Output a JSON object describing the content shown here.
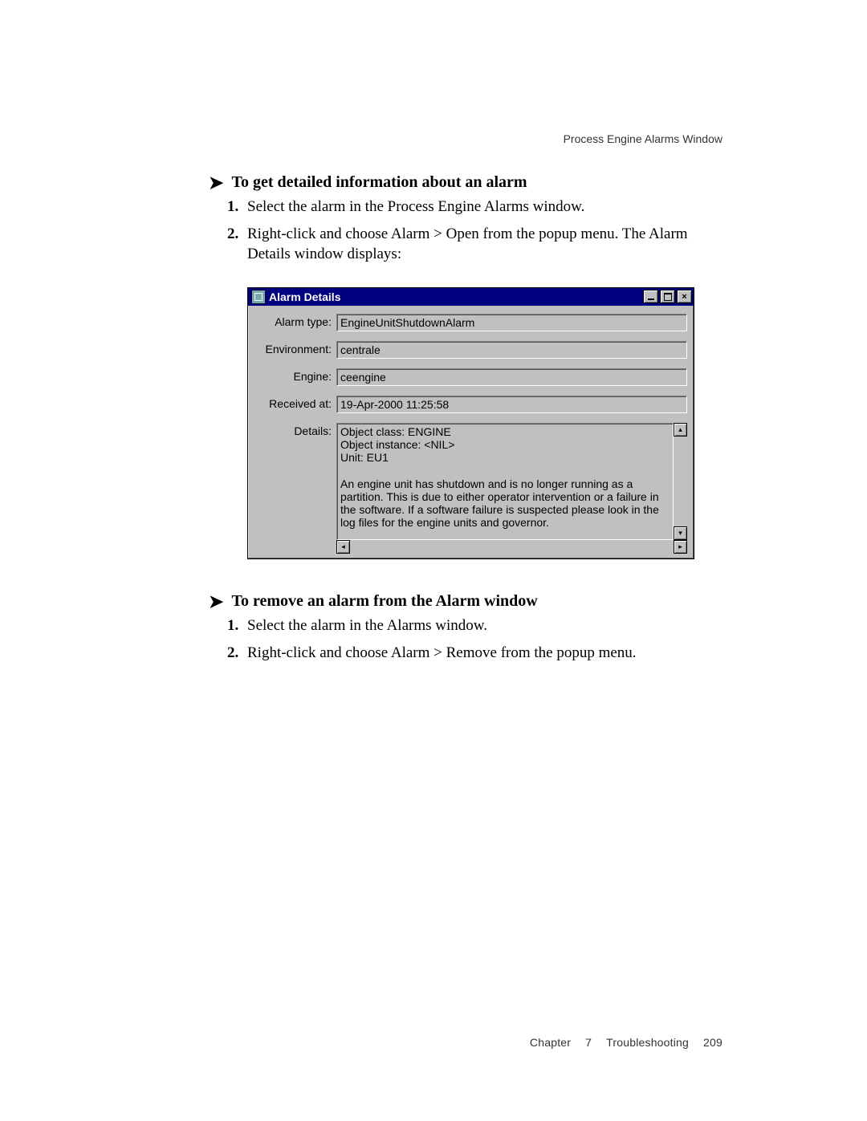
{
  "running_head": "Process Engine Alarms Window",
  "section1": {
    "heading": "To get detailed information about an alarm",
    "steps": [
      "Select the alarm in the Process Engine Alarms window.",
      "Right-click and choose Alarm > Open from the popup menu. The Alarm Details window displays:"
    ]
  },
  "alarm_details_window": {
    "title": "Alarm Details",
    "fields": {
      "alarm_type": {
        "label": "Alarm type:",
        "value": "EngineUnitShutdownAlarm"
      },
      "environment": {
        "label": "Environment:",
        "value": "centrale"
      },
      "engine": {
        "label": "Engine:",
        "value": "ceengine"
      },
      "received_at": {
        "label": "Received at:",
        "value": "19-Apr-2000 11:25:58"
      },
      "details": {
        "label": "Details:",
        "value": "Object class: ENGINE\nObject instance: <NIL>\nUnit: EU1\n\nAn engine unit has shutdown and is no longer running as a partition. This is due to either operator intervention or a failure in the software. If a software failure is suspected please look in the log files for the engine units and governor."
      }
    }
  },
  "section2": {
    "heading": "To remove an alarm from the Alarm window",
    "steps": [
      "Select the alarm in the Alarms window.",
      "Right-click and choose Alarm > Remove from the popup menu."
    ]
  },
  "footer": {
    "chapter_label": "Chapter",
    "chapter_num": "7",
    "chapter_title": "Troubleshooting",
    "page_num": "209"
  }
}
